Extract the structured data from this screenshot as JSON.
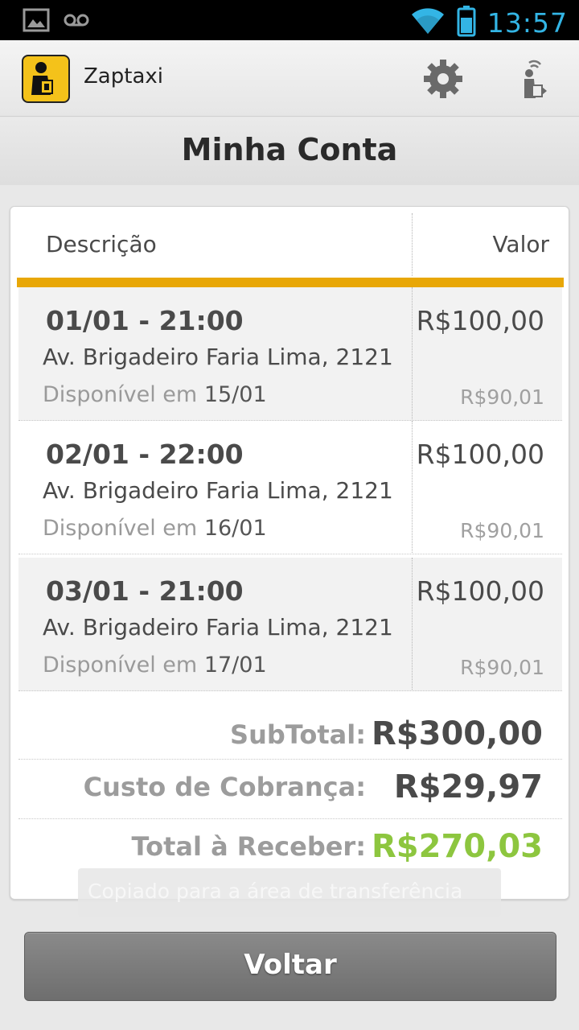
{
  "status_bar": {
    "time": "13:57",
    "icons": [
      "picture-notification-icon",
      "voicemail-icon",
      "wifi-icon",
      "battery-icon"
    ],
    "accent": "#33b5e5"
  },
  "app": {
    "name": "Zaptaxi",
    "brand_color": "#f4c21a"
  },
  "page": {
    "title": "Minha Conta"
  },
  "table": {
    "headers": {
      "description": "Descrição",
      "value": "Valor"
    },
    "accent_color": "#e8a707",
    "rows": [
      {
        "datetime": "01/01 - 21:00",
        "address": "Av. Brigadeiro Faria Lima, 2121",
        "available_prefix": "Disponível em",
        "available_date": "15/01",
        "value": "R$100,00",
        "net": "R$90,01"
      },
      {
        "datetime": "02/01 - 22:00",
        "address": "Av. Brigadeiro Faria Lima, 2121",
        "available_prefix": "Disponível em",
        "available_date": "16/01",
        "value": "R$100,00",
        "net": "R$90,01"
      },
      {
        "datetime": "03/01 - 21:00",
        "address": "Av. Brigadeiro Faria Lima, 2121",
        "available_prefix": "Disponível em",
        "available_date": "17/01",
        "value": "R$100,00",
        "net": "R$90,01"
      }
    ]
  },
  "summary": {
    "subtotal_label": "SubTotal:",
    "subtotal_value": "R$300,00",
    "fee_label": "Custo de Cobrança:",
    "fee_value": "R$29,97",
    "total_label": "Total à Receber:",
    "total_value": "R$270,03",
    "total_color": "#8dc63f"
  },
  "toast": {
    "text": "Copiado para a área de transferência"
  },
  "buttons": {
    "back_label": "Voltar"
  }
}
